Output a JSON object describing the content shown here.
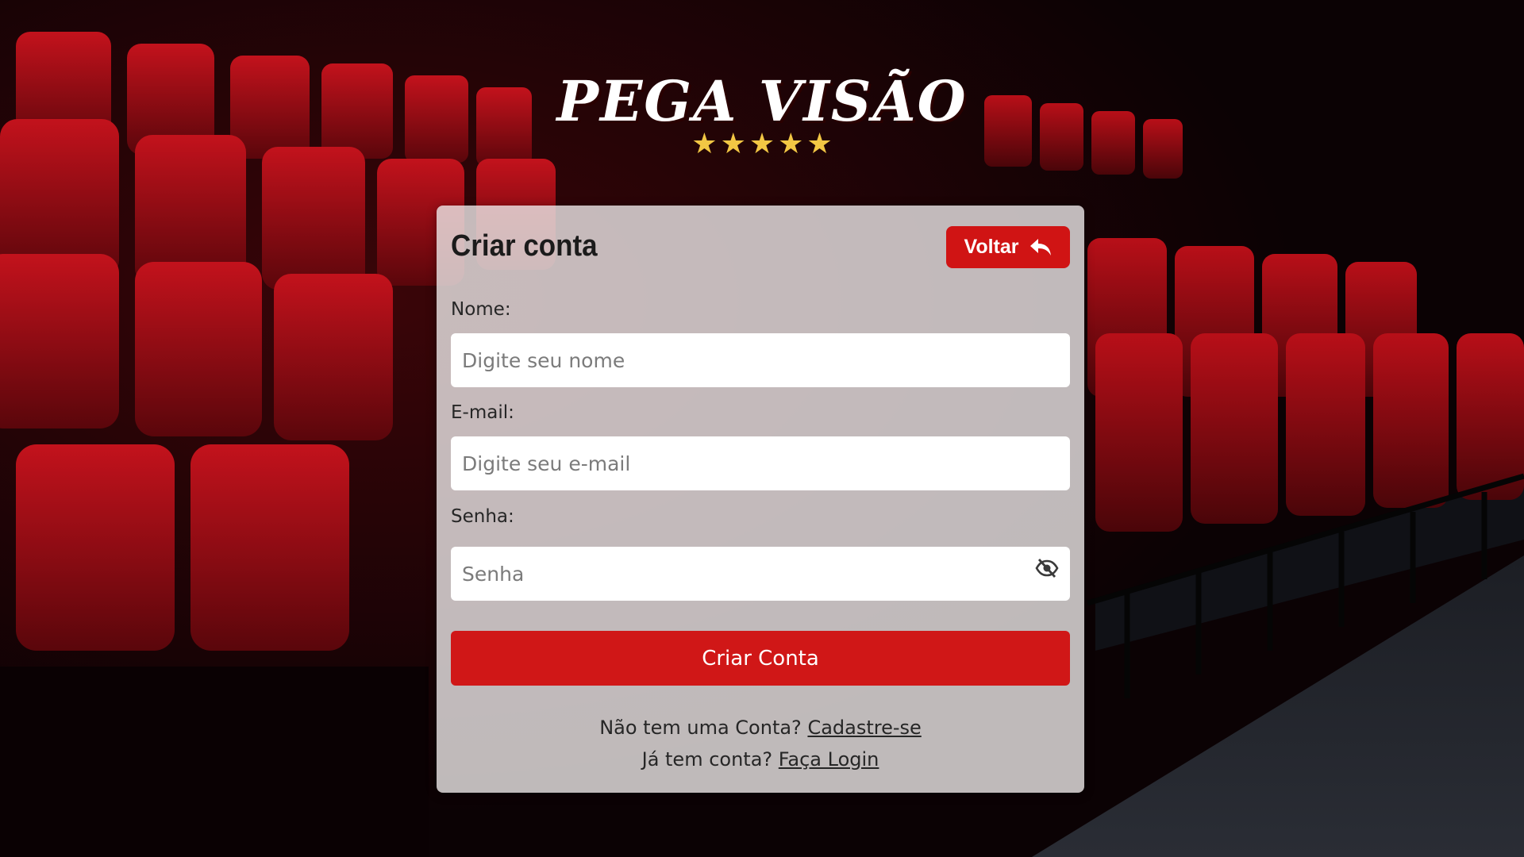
{
  "brand": {
    "name": "PEGA VISÃO",
    "stars": [
      "★",
      "★",
      "★",
      "★",
      "★"
    ],
    "star_color": "#f2c744"
  },
  "form": {
    "title": "Criar conta",
    "back_label": "Voltar",
    "name_label": "Nome:",
    "name_placeholder": "Digite seu nome",
    "email_label": "E-mail:",
    "email_placeholder": "Digite seu e-mail",
    "password_label": "Senha:",
    "password_placeholder": "Senha",
    "submit_label": "Criar Conta",
    "no_account_text": "Não tem uma Conta?",
    "signup_link": "Cadastre-se",
    "has_account_text": "Já tem conta?",
    "login_link": "Faça Login"
  },
  "colors": {
    "accent": "#d01717",
    "card_bg": "#ece8e9",
    "background": "#0b0204"
  },
  "icons": {
    "back": "reply-arrow-icon",
    "password_toggle": "eye-slash-icon"
  }
}
